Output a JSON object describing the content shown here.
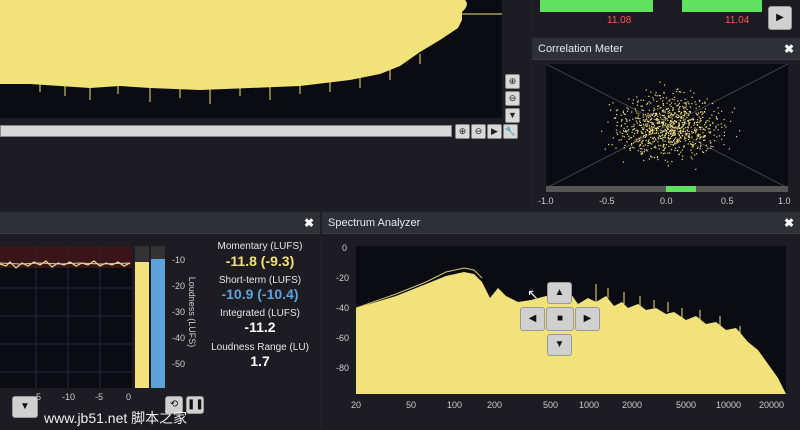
{
  "waveform": {
    "level_left": "11.08",
    "level_right": "11.04",
    "tools": {
      "zoom_in": "⊕",
      "zoom_out": "⊖",
      "play": "▶",
      "down": "▼",
      "wrench": "🔧"
    }
  },
  "correlation": {
    "title": "Correlation Meter",
    "close": "✖",
    "ticks": [
      "-1.0",
      "-0.5",
      "0.0",
      "0.5",
      "1.0"
    ]
  },
  "loudness": {
    "close": "✖",
    "momentary_label": "Momentary (LUFS)",
    "momentary_value": "-11.8 (-9.3)",
    "shortterm_label": "Short-term (LUFS)",
    "shortterm_value": "-10.9 (-10.4)",
    "integrated_label": "Integrated (LUFS)",
    "integrated_value": "-11.2",
    "range_label": "Loudness Range (LU)",
    "range_value": "1.7",
    "axis_title": "Loudness (LUFS)",
    "meter_ticks": [
      "-10",
      "-20",
      "-30",
      "-40",
      "-50"
    ],
    "time_ticks": [
      "5",
      "-10",
      "-5",
      "0"
    ],
    "colors": {
      "momentary": "#f2e27a",
      "shortterm": "#5ba3d9"
    }
  },
  "spectrum": {
    "title": "Spectrum Analyzer",
    "close": "✖",
    "y_ticks": [
      "0",
      "-20",
      "-40",
      "-60",
      "-80"
    ],
    "x_ticks": [
      "20",
      "50",
      "100",
      "200",
      "500",
      "1000",
      "2000",
      "5000",
      "10000",
      "20000"
    ]
  },
  "watermark": "www.jb51.net 脚本之家"
}
